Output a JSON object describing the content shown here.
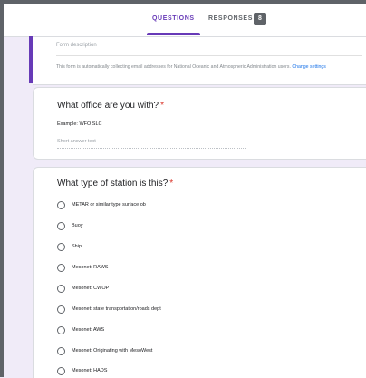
{
  "header": {
    "tabs": [
      {
        "label": "QUESTIONS"
      },
      {
        "label": "RESPONSES"
      }
    ],
    "response_count": "8",
    "accent_color": "#673ab7"
  },
  "form": {
    "description_placeholder": "Form description",
    "collect_note": "This form is automatically collecting email addresses for National Oceanic and Atmospheric Administration users.",
    "change_settings": "Change settings"
  },
  "questions": [
    {
      "title": "What office are you with?",
      "required_mark": "*",
      "help": "Example: WFO SLC",
      "placeholder": "Short answer text"
    },
    {
      "title": "What type of station is this?",
      "required_mark": "*",
      "options": [
        "METAR or similar type surface ob",
        "Buoy",
        "Ship",
        "Mesonet: RAWS",
        "Mesonet: CWOP",
        "Mesonet: state transportation/roads dept",
        "Mesonet: AWS",
        "Mesonet: Originating with MesoWest",
        "Mesonet: HADS"
      ]
    }
  ]
}
